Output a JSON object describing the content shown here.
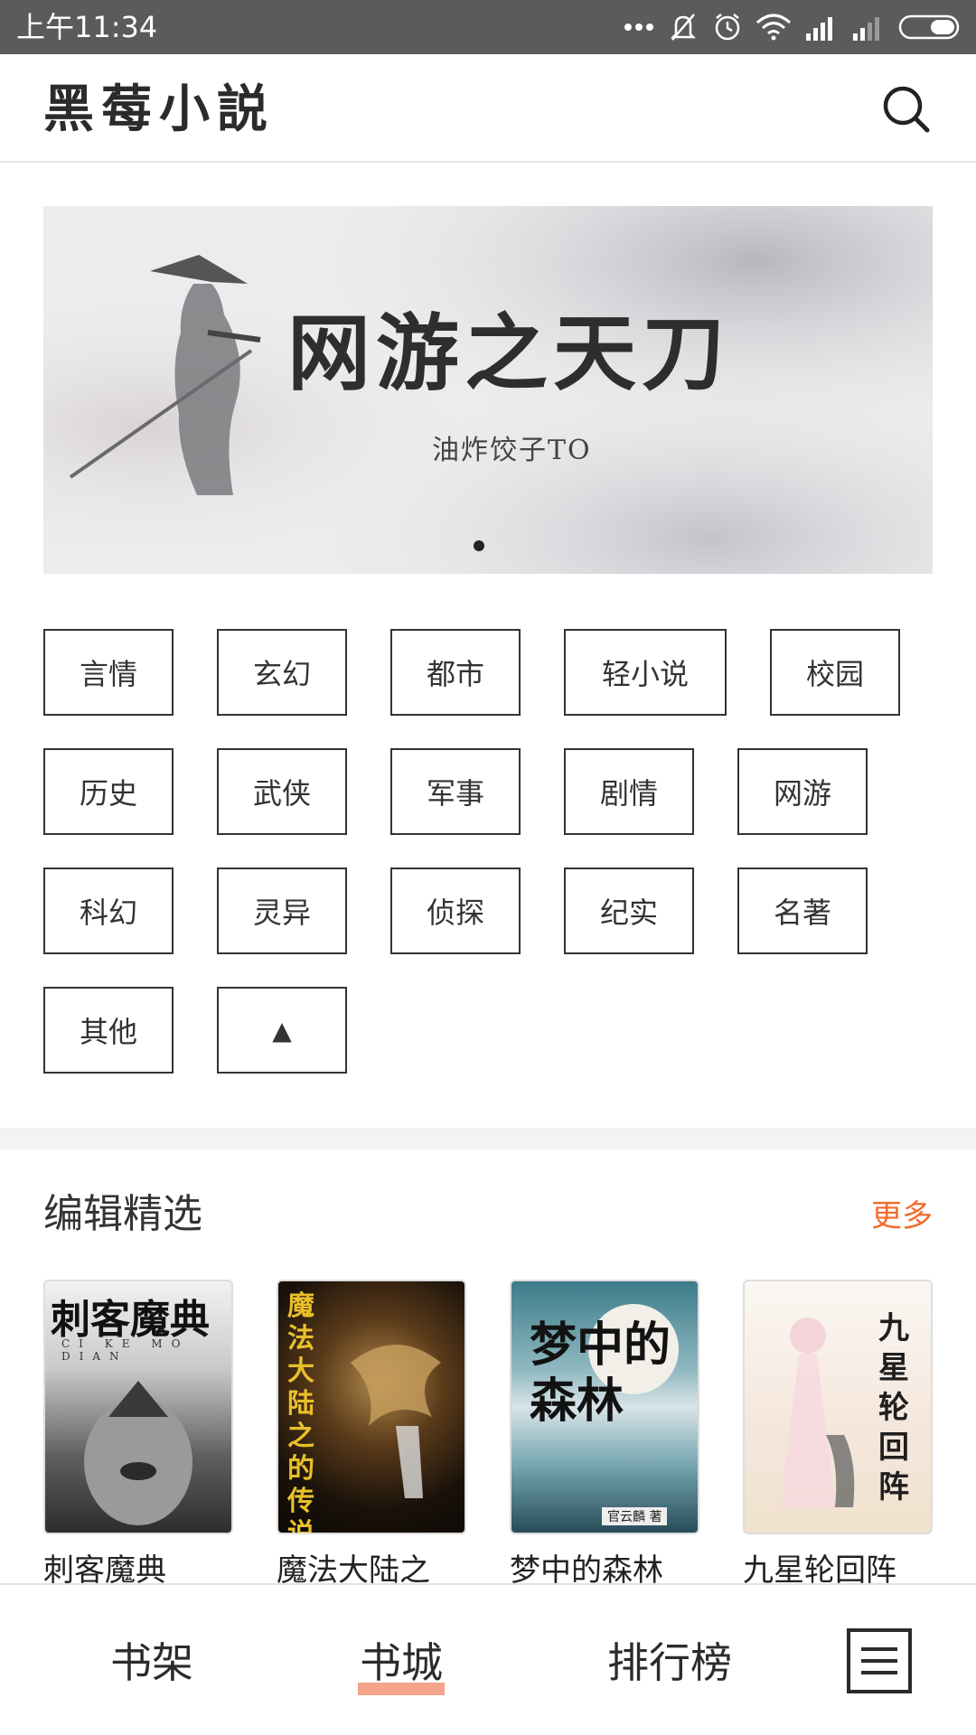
{
  "status_bar": {
    "time": "上午11:34"
  },
  "header": {
    "title": "黑莓小説"
  },
  "banner": {
    "title": "网游之天刀",
    "author": "油炸饺子TO"
  },
  "categories": [
    "言情",
    "玄幻",
    "都市",
    "轻小说",
    "校园",
    "历史",
    "武侠",
    "军事",
    "剧情",
    "网游",
    "科幻",
    "灵异",
    "侦探",
    "纪实",
    "名著",
    "其他"
  ],
  "categories_collapse_label": "▲",
  "editor_picks": {
    "title": "编辑精选",
    "more": "更多",
    "books": [
      {
        "name": "刺客魔典",
        "cover_text": "刺客魔典",
        "cover_sub": "CI KE MO DIAN"
      },
      {
        "name": "魔法大陆之",
        "cover_text": "魔法大陆之的传说"
      },
      {
        "name": "梦中的森林",
        "cover_text": "梦中的森林",
        "cover_sub": "官云麟 著"
      },
      {
        "name": "九星轮回阵",
        "cover_text": "九星轮回阵"
      }
    ]
  },
  "bottom_nav": {
    "items": [
      "书架",
      "书城",
      "排行榜"
    ],
    "active": "书城",
    "accent": "#f4a48a"
  },
  "colors": {
    "more_link": "#f26b2a",
    "status_bar": "#5b5b5b"
  }
}
